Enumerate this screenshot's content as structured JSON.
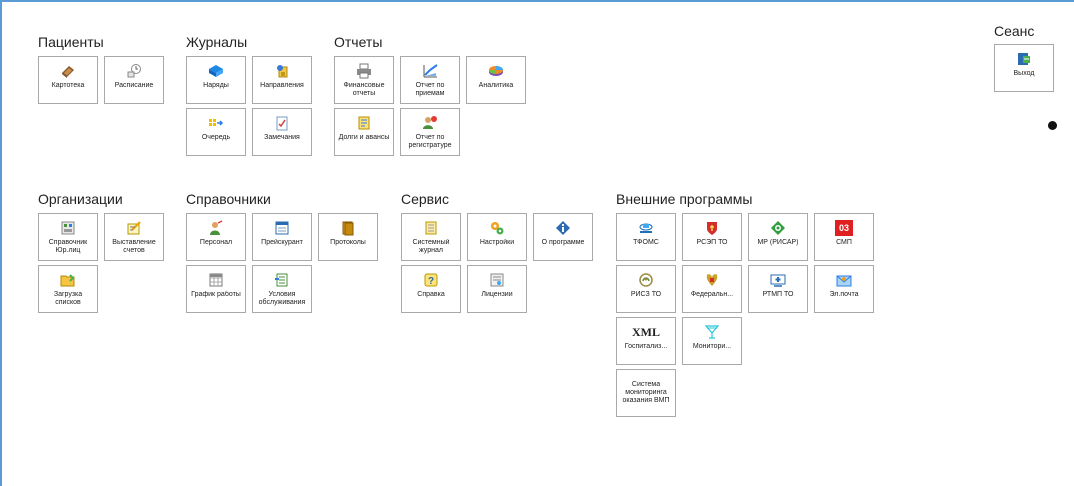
{
  "groups": {
    "patients": {
      "title": "Пациенты",
      "tiles": [
        {
          "label": "Картотека",
          "icon": "card-file-icon"
        },
        {
          "label": "Расписание",
          "icon": "schedule-icon"
        }
      ]
    },
    "journals": {
      "title": "Журналы",
      "tiles": [
        {
          "label": "Наряды",
          "icon": "orders-icon"
        },
        {
          "label": "Направления",
          "icon": "referrals-icon"
        },
        {
          "label": "Очередь",
          "icon": "queue-icon"
        },
        {
          "label": "Замечания",
          "icon": "remarks-icon"
        }
      ]
    },
    "reports": {
      "title": "Отчеты",
      "tiles": [
        {
          "label": "Финансовые отчеты",
          "icon": "printer-icon"
        },
        {
          "label": "Отчет по приемам",
          "icon": "chart-icon"
        },
        {
          "label": "Аналитика",
          "icon": "analytics-icon"
        },
        {
          "label": "Долги и авансы",
          "icon": "debts-icon"
        },
        {
          "label": "Отчет по регистратуре",
          "icon": "registry-report-icon"
        }
      ]
    },
    "session": {
      "title": "Сеанс",
      "tiles": [
        {
          "label": "Выход",
          "icon": "exit-icon"
        }
      ]
    },
    "organizations": {
      "title": "Организации",
      "tiles": [
        {
          "label": "Справочник Юр.лиц",
          "icon": "legal-entities-icon"
        },
        {
          "label": "Выставление счетов",
          "icon": "invoice-icon"
        },
        {
          "label": "Загрузка списков",
          "icon": "folder-load-icon"
        }
      ]
    },
    "directories": {
      "title": "Справочники",
      "tiles": [
        {
          "label": "Персонал",
          "icon": "staff-icon"
        },
        {
          "label": "Прейскурант",
          "icon": "price-list-icon"
        },
        {
          "label": "Протоколы",
          "icon": "protocols-icon"
        },
        {
          "label": "График работы",
          "icon": "work-schedule-icon"
        },
        {
          "label": "Условия обслуживания",
          "icon": "service-terms-icon"
        }
      ]
    },
    "service": {
      "title": "Сервис",
      "tiles": [
        {
          "label": "Системный журнал",
          "icon": "system-log-icon"
        },
        {
          "label": "Настройки",
          "icon": "settings-icon"
        },
        {
          "label": "О программе",
          "icon": "info-icon"
        },
        {
          "label": "Справка",
          "icon": "help-icon"
        },
        {
          "label": "Лицензии",
          "icon": "license-icon"
        }
      ]
    },
    "external": {
      "title": "Внешние программы",
      "tiles": [
        {
          "label": "ТФОМС",
          "icon": "tfoms-icon"
        },
        {
          "label": "РСЭП ТО",
          "icon": "rsep-icon"
        },
        {
          "label": "МР (РИСАР)",
          "icon": "risar-icon"
        },
        {
          "label": "СМП",
          "icon": "smp-icon",
          "badge": "03"
        },
        {
          "label": "РИСЗ ТО",
          "icon": "risz-icon"
        },
        {
          "label": "Федеральн...",
          "icon": "federal-emblem-icon"
        },
        {
          "label": "РТМП ТО",
          "icon": "rtmp-icon"
        },
        {
          "label": "Эл.почта",
          "icon": "email-icon"
        },
        {
          "label": "Госпитализ...",
          "icon": "xml-icon",
          "badge": "XML"
        },
        {
          "label": "Монитори...",
          "icon": "monitoring-icon"
        },
        {
          "label": "Система мониторинга оказания ВМП",
          "icon": ""
        }
      ]
    }
  },
  "colors": {
    "frame_accent": "#5b9bd5",
    "tile_border": "#a9a9a9",
    "smp_red": "#e02020"
  }
}
